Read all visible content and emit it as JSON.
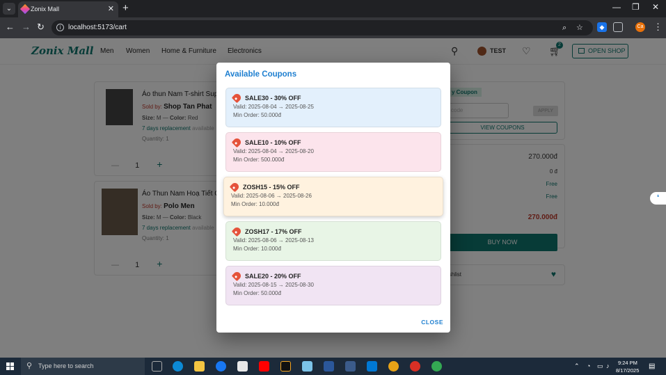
{
  "browser": {
    "tab_title": "Zonix Mall",
    "url": "localhost:5173/cart",
    "profile_initial": "Ca"
  },
  "header": {
    "logo": "Zonix Mall",
    "menu": [
      "Men",
      "Women",
      "Home & Furniture",
      "Electronics"
    ],
    "user": "TEST",
    "cart_count": "2",
    "open_shop": "OPEN SHOP"
  },
  "cart_items": [
    {
      "title": "Áo thun Nam T-shirt Sup",
      "sold_by_label": "Sold by:",
      "seller": "Shop Tan Phat",
      "size_label": "Size:",
      "size": "M",
      "color_label": "Color:",
      "color": "Red",
      "replacement": "7 days replacement",
      "available": "available",
      "quantity_text": "Quantity: 1",
      "qty": "1"
    },
    {
      "title": "Áo Thun Nam Hoạ Tiết O",
      "sold_by_label": "Sold by:",
      "seller": "Polo Men",
      "size_label": "Size:",
      "size": "M",
      "color_label": "Color:",
      "color": "Black",
      "replacement": "7 days replacement",
      "available": "available",
      "quantity_text": "Quantity: 1",
      "qty": "1"
    }
  ],
  "summary": {
    "coupon_label": "y Coupon",
    "coupon_placeholder": "code",
    "apply": "APPLY",
    "view_coupons": "VIEW COUPONS",
    "subtotal": "270.000đ",
    "discount": "0 đ",
    "shipping": "Free",
    "fee_label": "e",
    "fee": "Free",
    "total": "270.000đ",
    "buy_now": "BUY NOW",
    "wishlist": "ishlist"
  },
  "modal": {
    "title": "Available Coupons",
    "close": "CLOSE",
    "coupons": [
      {
        "name": "SALE30 - 30% OFF",
        "valid": "Valid: 2025-08-04 → 2025-08-25",
        "min_order": "Min Order: 50.000đ",
        "bg": "#e3f0fc"
      },
      {
        "name": "SALE10 - 10% OFF",
        "valid": "Valid: 2025-08-04 → 2025-08-20",
        "min_order": "Min Order: 500.000đ",
        "bg": "#fce4ec"
      },
      {
        "name": "ZOSH15 - 15% OFF",
        "valid": "Valid: 2025-08-06 → 2025-08-26",
        "min_order": "Min Order: 10.000đ",
        "bg": "#fff2df"
      },
      {
        "name": "ZOSH17 - 17% OFF",
        "valid": "Valid: 2025-08-06 → 2025-08-13",
        "min_order": "Min Order: 10.000đ",
        "bg": "#e8f5e6"
      },
      {
        "name": "SALE20 - 20% OFF",
        "valid": "Valid: 2025-08-15 → 2025-08-30",
        "min_order": "Min Order: 50.000đ",
        "bg": "#f1e4f3"
      }
    ]
  },
  "taskbar": {
    "search_placeholder": "Type here to search",
    "time": "9:24 PM",
    "date": "8/17/2025"
  },
  "colors": {
    "brand": "#0f766e",
    "accent": "#1e7fd0",
    "total": "#c0392b"
  }
}
